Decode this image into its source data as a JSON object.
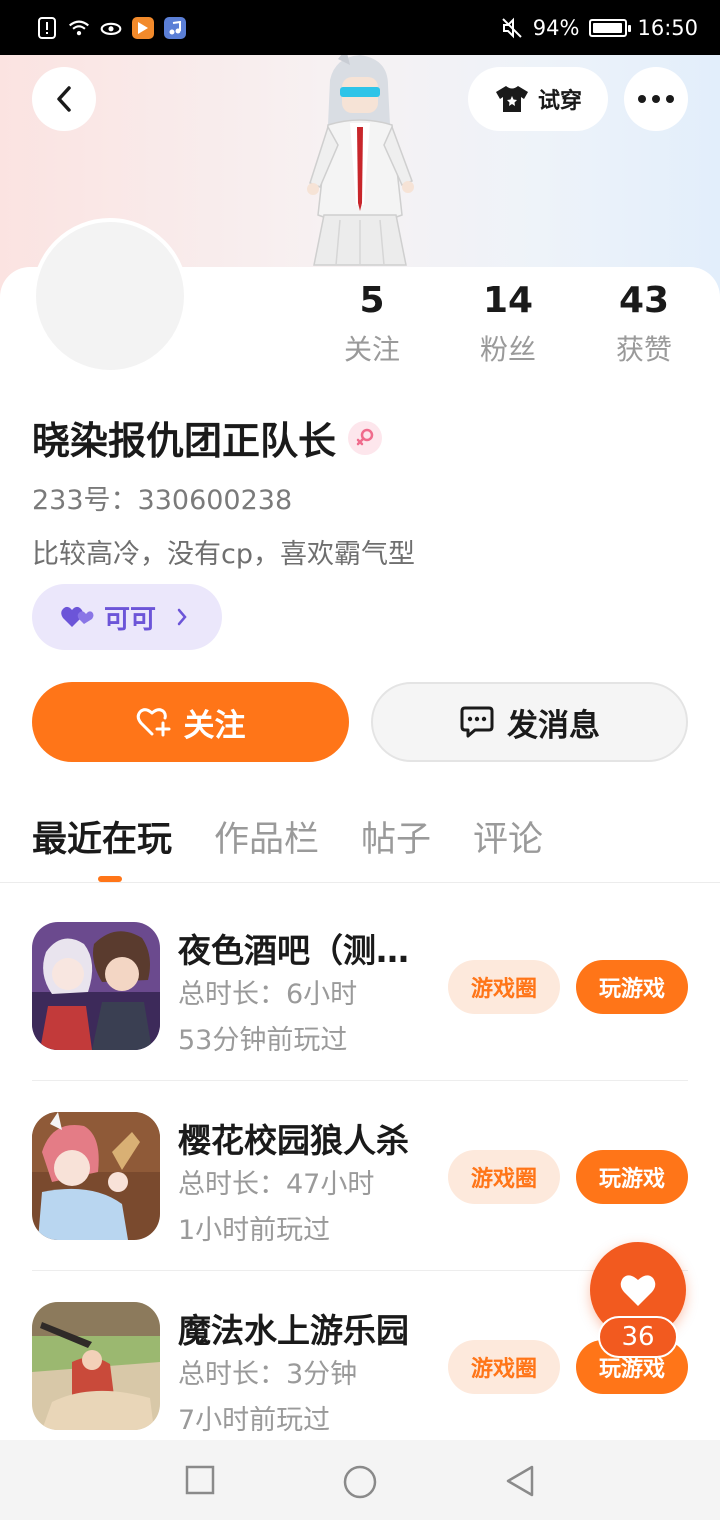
{
  "status_bar": {
    "battery_percent": "94%",
    "battery_level": 0.94,
    "time": "16:50",
    "icons": [
      "alert-icon",
      "wifi-icon",
      "eye-icon",
      "video-app-icon",
      "music-app-icon",
      "mute-icon"
    ]
  },
  "header": {
    "try_on_label": "试穿",
    "try_on_icon": "tshirt-icon",
    "back_icon": "chevron-left-icon",
    "more_icon": "more-dots-icon"
  },
  "profile": {
    "stats": [
      {
        "value": "5",
        "label": "关注"
      },
      {
        "value": "14",
        "label": "粉丝"
      },
      {
        "value": "43",
        "label": "获赞"
      }
    ],
    "name": "晓染报仇团正队长",
    "gender": "female",
    "uid": "233号：330600238",
    "bio": "比较高冷，没有cp，喜欢霸气型",
    "cp_tag": "可可"
  },
  "actions": {
    "follow_label": "关注",
    "message_label": "发消息"
  },
  "tabs": [
    {
      "label": "最近在玩",
      "active": true
    },
    {
      "label": "作品栏",
      "active": false
    },
    {
      "label": "帖子",
      "active": false
    },
    {
      "label": "评论",
      "active": false
    }
  ],
  "games": [
    {
      "title": "夜色酒吧（测…",
      "duration": "总时长：6小时",
      "last_played": "53分钟前玩过",
      "circle_label": "游戏圈",
      "play_label": "玩游戏"
    },
    {
      "title": "樱花校园狼人杀",
      "duration": "总时长：47小时",
      "last_played": "1小时前玩过",
      "circle_label": "游戏圈",
      "play_label": "玩游戏"
    },
    {
      "title": "魔法水上游乐园",
      "duration": "总时长：3分钟",
      "last_played": "7小时前玩过",
      "circle_label": "游戏圈",
      "play_label": "玩游戏"
    }
  ],
  "like": {
    "count": "36"
  },
  "colors": {
    "accent": "#ff7518",
    "cp_purple": "#6c55d8",
    "like_red": "#f25a1f"
  }
}
